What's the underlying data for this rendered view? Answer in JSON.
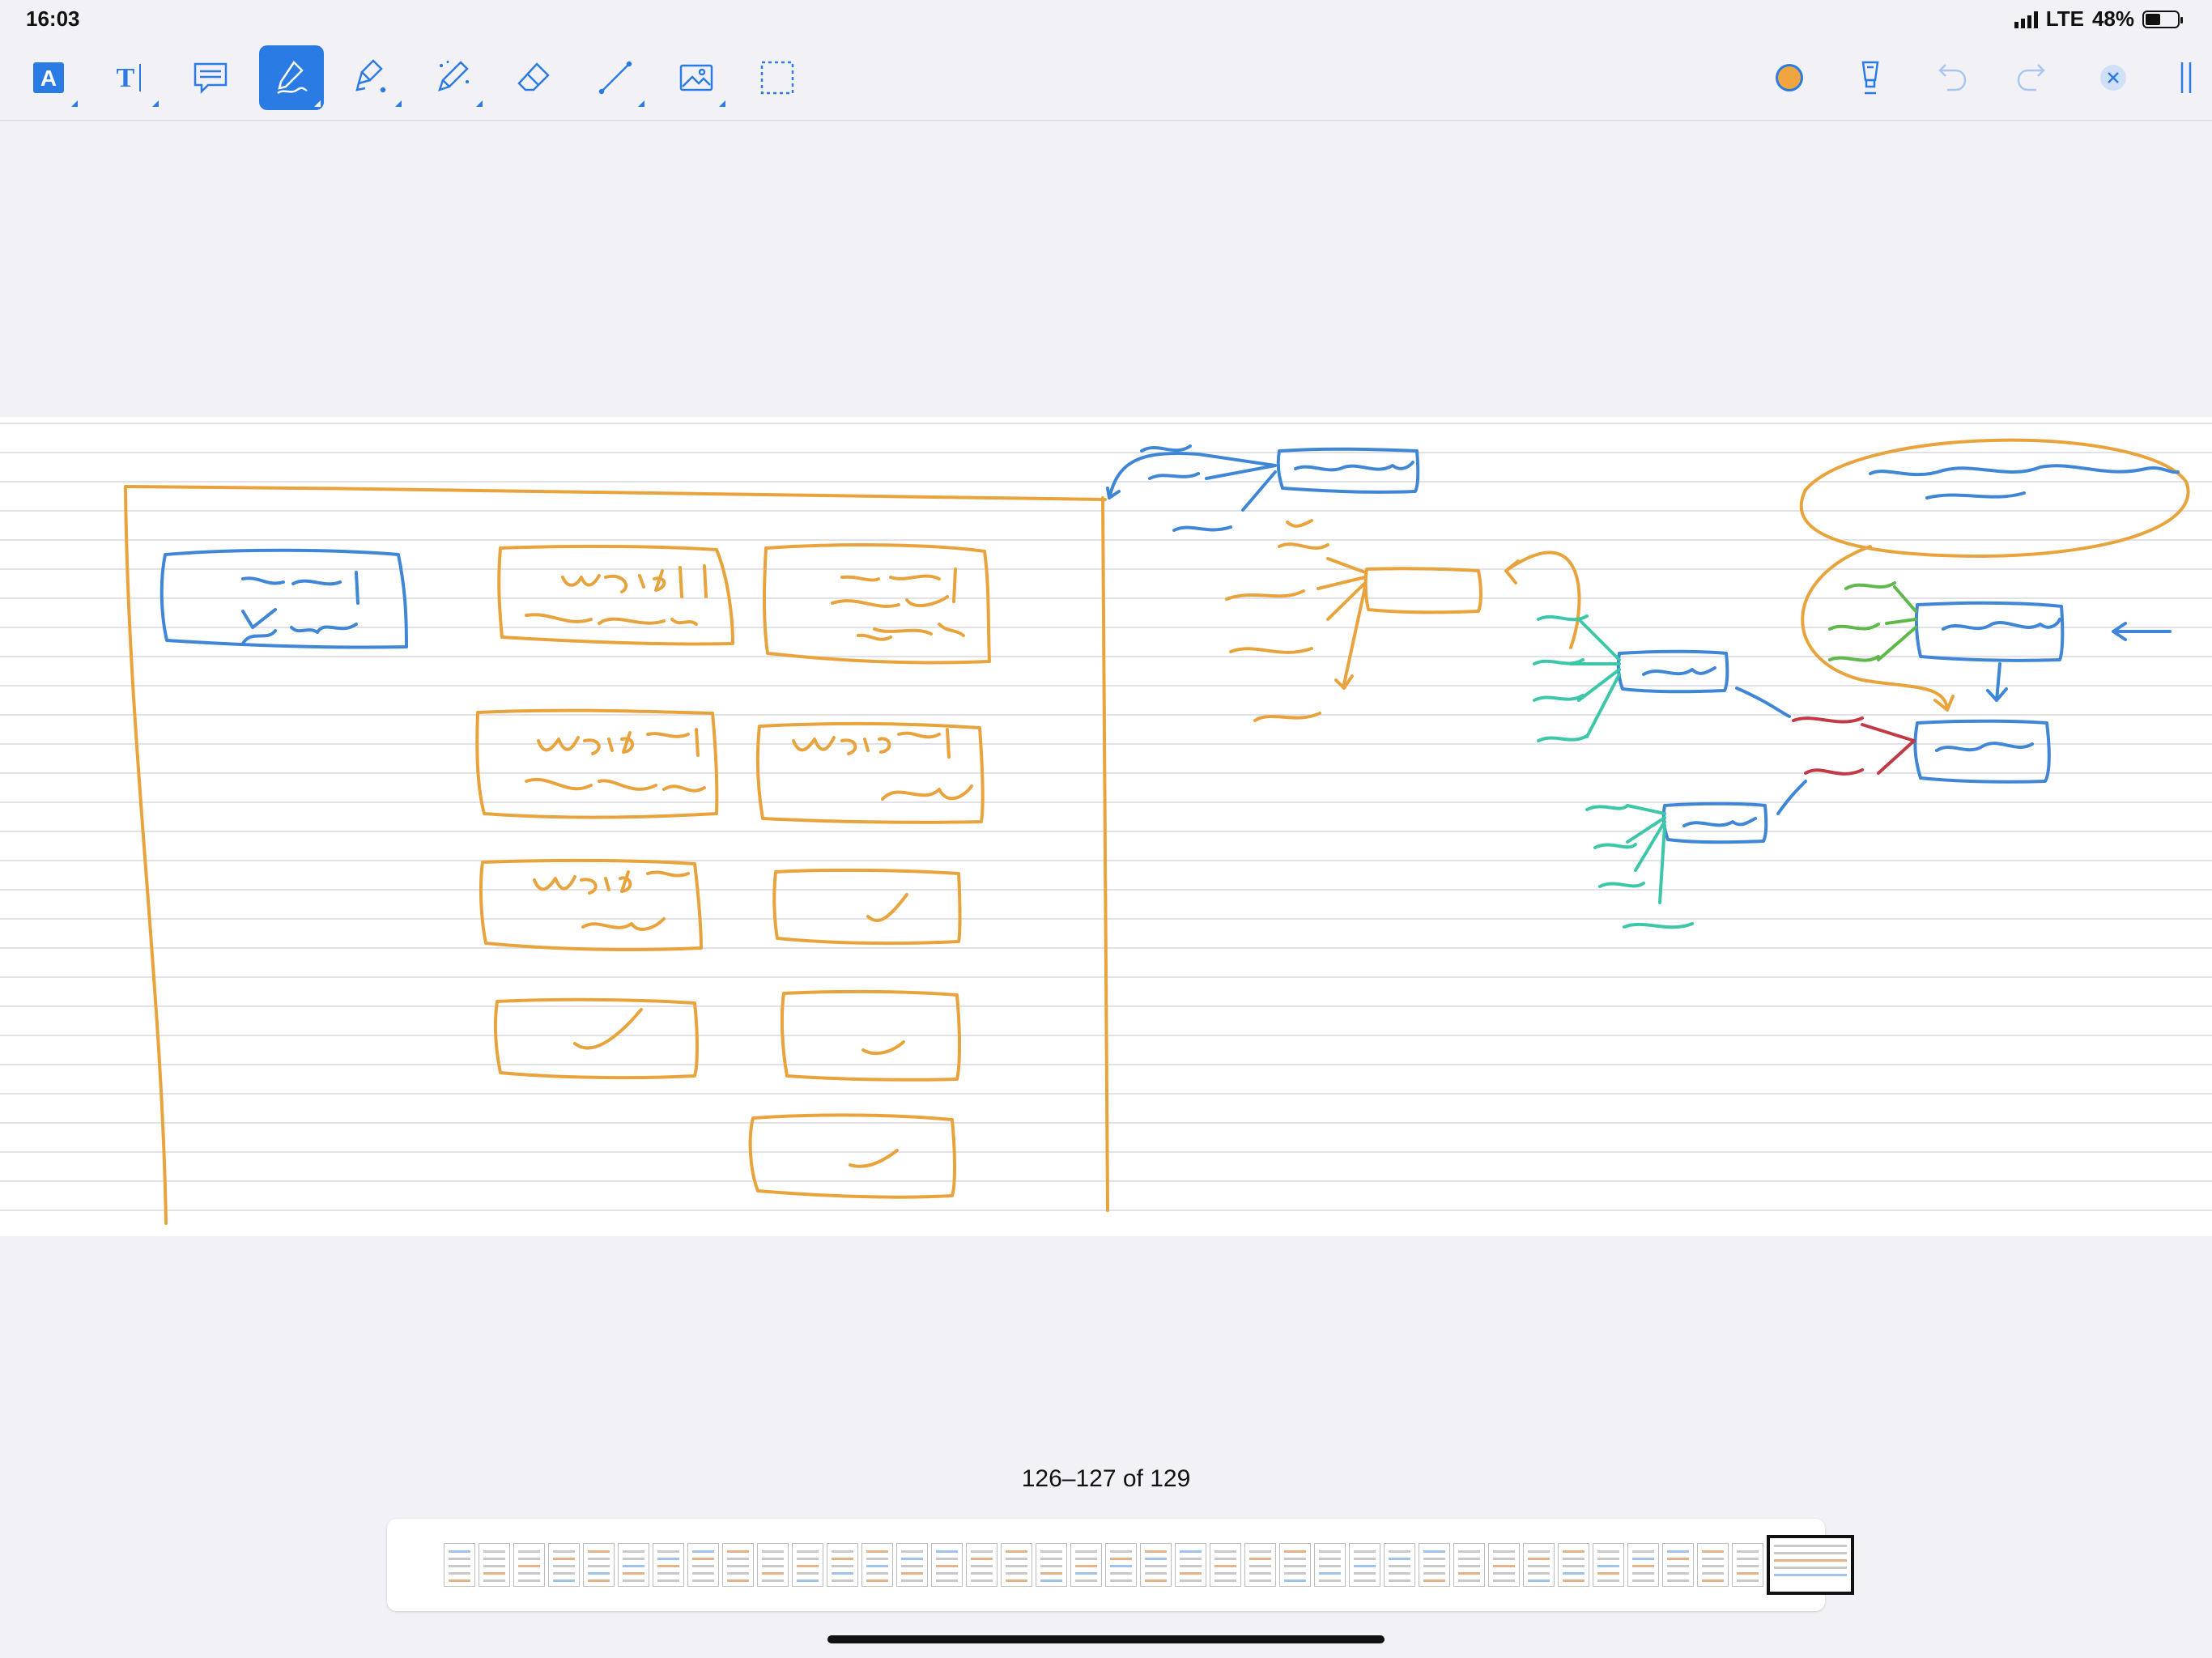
{
  "status": {
    "time": "16:03",
    "network": "LTE",
    "battery_percent": "48%",
    "battery_level": 0.48
  },
  "toolbar": {
    "tools": [
      {
        "name": "text-style-tool",
        "icon": "text-box-icon",
        "label": "A"
      },
      {
        "name": "text-tool",
        "icon": "text-cursor-icon",
        "label": "T"
      },
      {
        "name": "comment-tool",
        "icon": "comment-icon"
      },
      {
        "name": "pen-tool",
        "icon": "pen-icon",
        "active": true
      },
      {
        "name": "highlighter-tool",
        "icon": "highlighter-icon"
      },
      {
        "name": "magic-pen-tool",
        "icon": "magic-wand-icon"
      },
      {
        "name": "eraser-tool",
        "icon": "eraser-icon"
      },
      {
        "name": "line-tool",
        "icon": "line-icon"
      },
      {
        "name": "image-tool",
        "icon": "image-icon"
      },
      {
        "name": "lasso-tool",
        "icon": "selection-icon"
      }
    ],
    "right_tools": [
      "color-picker-icon",
      "stroke-width-icon",
      "undo-icon",
      "redo-icon",
      "close-icon",
      "hide-toolbar-icon"
    ],
    "pen_color": "#f0a540"
  },
  "ink_colors": {
    "orange": "#e8a33c",
    "blue": "#3f86d6",
    "green": "#5fb94a",
    "teal": "#3cc7a8",
    "red": "#c23a45"
  },
  "navigator": {
    "page_range": "126–127 of 129",
    "thumbnail_count": 39
  }
}
